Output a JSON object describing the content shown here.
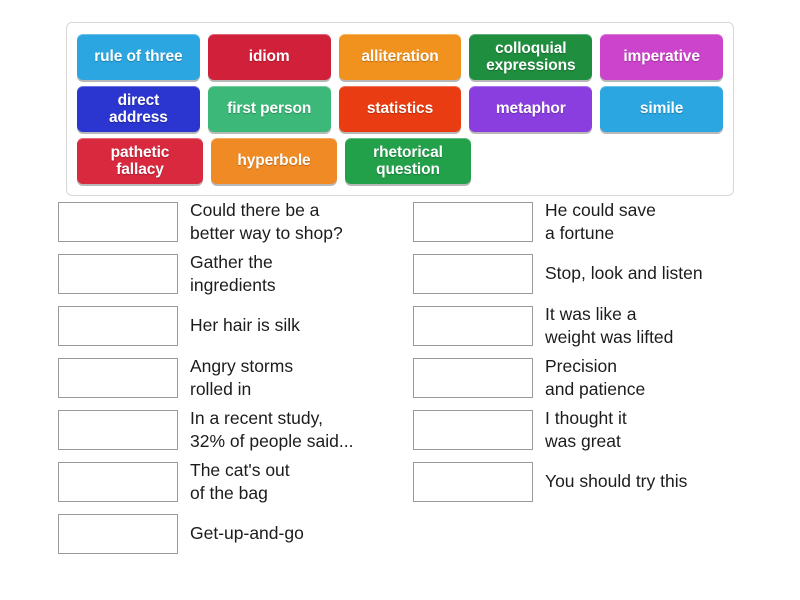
{
  "tile_bank": {
    "name": "answer-tile-bank",
    "rows": [
      [
        {
          "label": "rule of three",
          "color": "#2ba6e0"
        },
        {
          "label": "idiom",
          "color": "#d1213a"
        },
        {
          "label": "alliteration",
          "color": "#f2921e"
        },
        {
          "label": "colloquial\nexpressions",
          "color": "#1f8f3f"
        },
        {
          "label": "imperative",
          "color": "#cc44cc"
        }
      ],
      [
        {
          "label": "direct\naddress",
          "color": "#2b35d0"
        },
        {
          "label": "first person",
          "color": "#3cb878"
        },
        {
          "label": "statistics",
          "color": "#ea3c12"
        },
        {
          "label": "metaphor",
          "color": "#8a3ee0"
        },
        {
          "label": "simile",
          "color": "#2ba6e0"
        }
      ],
      [
        {
          "label": "pathetic\nfallacy",
          "color": "#d8293f"
        },
        {
          "label": "hyperbole",
          "color": "#f08a24"
        },
        {
          "label": "rhetorical\nquestion",
          "color": "#22a04a"
        }
      ]
    ]
  },
  "questions": {
    "left_column": [
      {
        "answer": "",
        "text": "Could there be a\nbetter way to shop?"
      },
      {
        "answer": "",
        "text": "Gather the\ningredients"
      },
      {
        "answer": "",
        "text": "Her hair is silk"
      },
      {
        "answer": "",
        "text": "Angry storms\nrolled in"
      },
      {
        "answer": "",
        "text": "In a recent study,\n32% of people said..."
      },
      {
        "answer": "",
        "text": "The cat's out\nof the bag"
      },
      {
        "answer": "",
        "text": "Get-up-and-go"
      }
    ],
    "right_column": [
      {
        "answer": "",
        "text": "He could save\na fortune"
      },
      {
        "answer": "",
        "text": "Stop, look and listen"
      },
      {
        "answer": "",
        "text": "It was like a\nweight was lifted"
      },
      {
        "answer": "",
        "text": "Precision\nand patience"
      },
      {
        "answer": "",
        "text": "I thought it\nwas great"
      },
      {
        "answer": "",
        "text": "You should try this"
      }
    ]
  },
  "colors": {
    "panel_border": "#d8d8d8",
    "drop_box_border": "#9a9a9a",
    "text": "#1c1c1c",
    "background": "#ffffff"
  }
}
